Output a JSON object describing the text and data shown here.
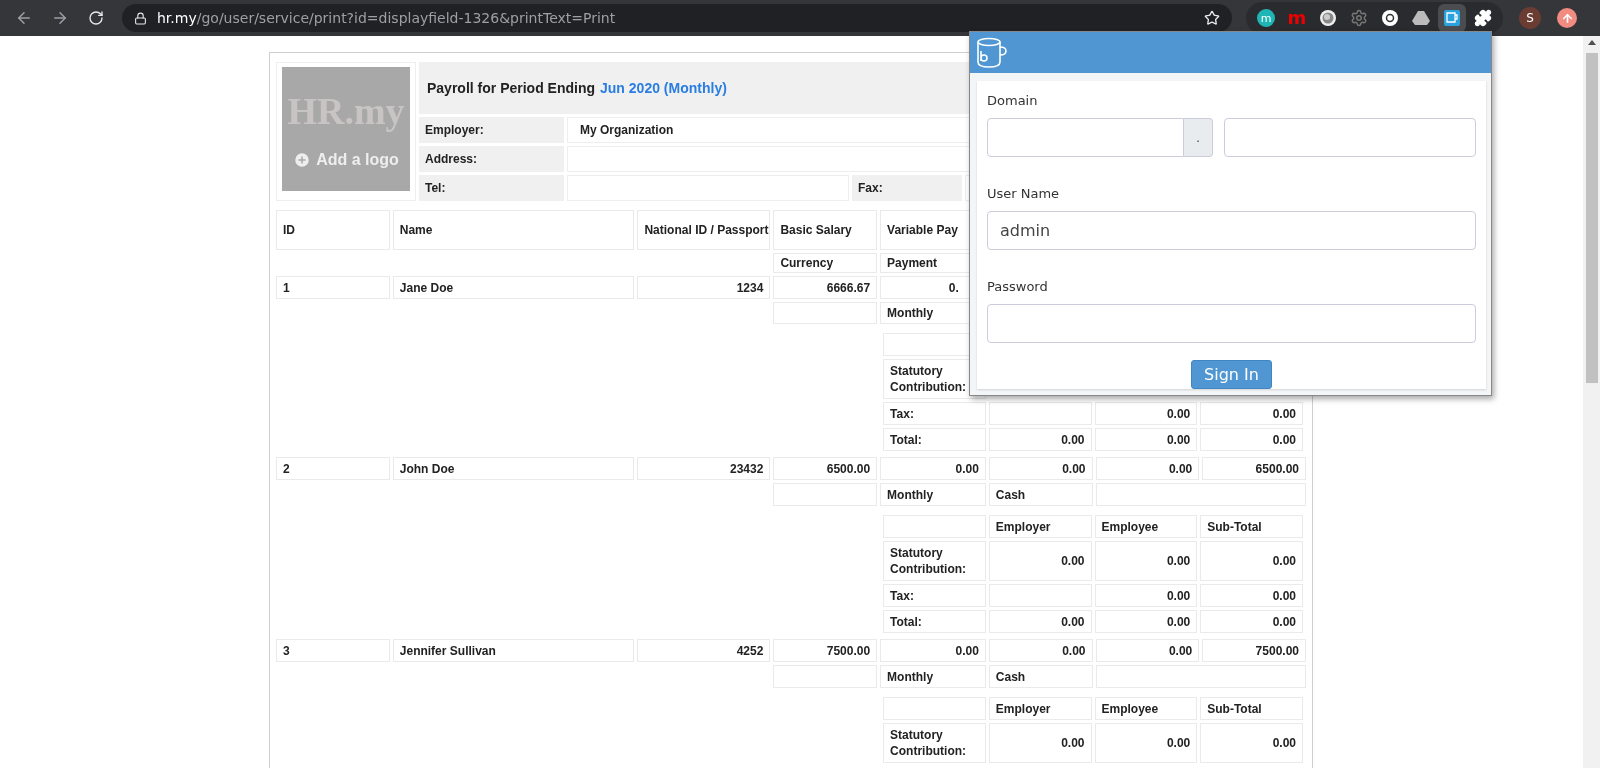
{
  "browser": {
    "url_host": "hr.my",
    "url_path": "/go/user/service/print?id=displayfield-1326&printText=Print",
    "extensions": [
      {
        "kind": "badge",
        "label": "m",
        "selected": false
      },
      {
        "kind": "letter",
        "label": "m",
        "selected": false
      },
      {
        "kind": "orb",
        "selected": false
      },
      {
        "kind": "gear",
        "selected": false
      },
      {
        "kind": "ring",
        "selected": false
      },
      {
        "kind": "drive",
        "selected": false
      },
      {
        "kind": "mug",
        "selected": true
      },
      {
        "kind": "puzzle",
        "selected": false
      }
    ],
    "profile": "S"
  },
  "report": {
    "title": "Payroll for Period Ending",
    "period": "Jun 2020 (Monthly)",
    "logo_watermark": "HR.my",
    "logo_action": "Add a logo",
    "employer_label": "Employer:",
    "employer": "My Organization",
    "address_label": "Address:",
    "tel_label": "Tel:",
    "fax_label": "Fax:"
  },
  "table": {
    "columns": [
      "ID",
      "Name",
      "National ID / Passport",
      "Basic Salary",
      "Variable Pay"
    ],
    "subcolumns": [
      "Currency",
      "Payment"
    ],
    "rows": [
      {
        "cells": [
          "1",
          "Jane Doe",
          "1234",
          "6666.67",
          "0."
        ],
        "payment": "Monthly",
        "breakdown": {
          "rows": [
            {
              "label": "Statutory Contribution:"
            },
            {
              "label": "Tax:",
              "employee": "0.00",
              "subtotal": "0.00"
            },
            {
              "label": "Total:",
              "employer": "0.00",
              "employee": "0.00",
              "subtotal": "0.00"
            }
          ]
        }
      },
      {
        "cells": [
          "2",
          "John Doe",
          "23432",
          "6500.00",
          "0.00",
          "0.00",
          "0.00",
          "6500.00"
        ],
        "payment": "Monthly",
        "method": "Cash",
        "breakdown": {
          "header": [
            "Employer",
            "Employee",
            "Sub-Total"
          ],
          "rows": [
            {
              "label": "Statutory Contribution:",
              "employer": "0.00",
              "employee": "0.00",
              "subtotal": "0.00"
            },
            {
              "label": "Tax:",
              "employee": "0.00",
              "subtotal": "0.00"
            },
            {
              "label": "Total:",
              "employer": "0.00",
              "employee": "0.00",
              "subtotal": "0.00"
            }
          ]
        }
      },
      {
        "cells": [
          "3",
          "Jennifer Sullivan",
          "4252",
          "7500.00",
          "0.00",
          "0.00",
          "0.00",
          "7500.00"
        ],
        "payment": "Monthly",
        "method": "Cash",
        "breakdown": {
          "header": [
            "Employer",
            "Employee",
            "Sub-Total"
          ],
          "rows": [
            {
              "label": "Statutory Contribution:",
              "employer": "0.00",
              "employee": "0.00",
              "subtotal": "0.00"
            }
          ]
        }
      }
    ]
  },
  "login": {
    "domain_label": "Domain",
    "domain_separator": ".",
    "username_label": "User Name",
    "username": "admin",
    "password_label": "Password",
    "submit": "Sign In"
  }
}
